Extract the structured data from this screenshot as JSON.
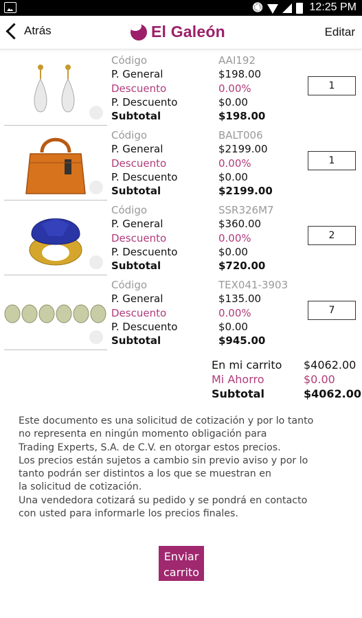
{
  "status_bar": {
    "time": "12:25 PM"
  },
  "app_bar": {
    "back_label": "Atrás",
    "logo_text": "El Galeón",
    "edit_label": "Editar"
  },
  "field_labels": {
    "code": "Código",
    "general_price": "P. General",
    "discount": "Descuento",
    "discount_price": "P. Descuento",
    "subtotal": "Subtotal"
  },
  "items": [
    {
      "image": "drop-earrings",
      "code": "AAI192",
      "general_price": "$198.00",
      "discount": "0.00%",
      "discount_price": "$0.00",
      "subtotal": "$198.00",
      "quantity": "1"
    },
    {
      "image": "orange-handbag",
      "code": "BALT006",
      "general_price": "$2199.00",
      "discount": "0.00%",
      "discount_price": "$0.00",
      "subtotal": "$2199.00",
      "quantity": "1"
    },
    {
      "image": "blue-gold-ring",
      "code": "SSR326M7",
      "general_price": "$360.00",
      "discount": "0.00%",
      "discount_price": "$0.00",
      "subtotal": "$720.00",
      "quantity": "2"
    },
    {
      "image": "crystal-bead-strand",
      "code": "TEX041-3903",
      "general_price": "$135.00",
      "discount": "0.00%",
      "discount_price": "$0.00",
      "subtotal": "$945.00",
      "quantity": "7"
    }
  ],
  "totals": {
    "in_cart_label": "En mi carrito",
    "in_cart_value": "$4062.00",
    "savings_label": "Mi Ahorro",
    "savings_value": "$0.00",
    "subtotal_label": "Subtotal",
    "subtotal_value": "$4062.00"
  },
  "disclaimer": "Este documento es una solicitud de cotización y por lo tanto\nno representa en ningún momento obligación para\nTrading Experts, S.A. de C.V. en otorgar estos precios.\nLos precios están sujetos a cambio sin previo aviso y por lo\ntanto podrán ser distintos a los que se muestran en\nla solicitud de cotización.\nUna vendedora cotizará su pedido y se pondrá en contacto\ncon usted para informarle los precios finales.",
  "send_button": "Enviar carrito",
  "colors": {
    "brand": "#9c1f6a",
    "accent_text": "#b03a7a",
    "button": "#a0286f"
  }
}
